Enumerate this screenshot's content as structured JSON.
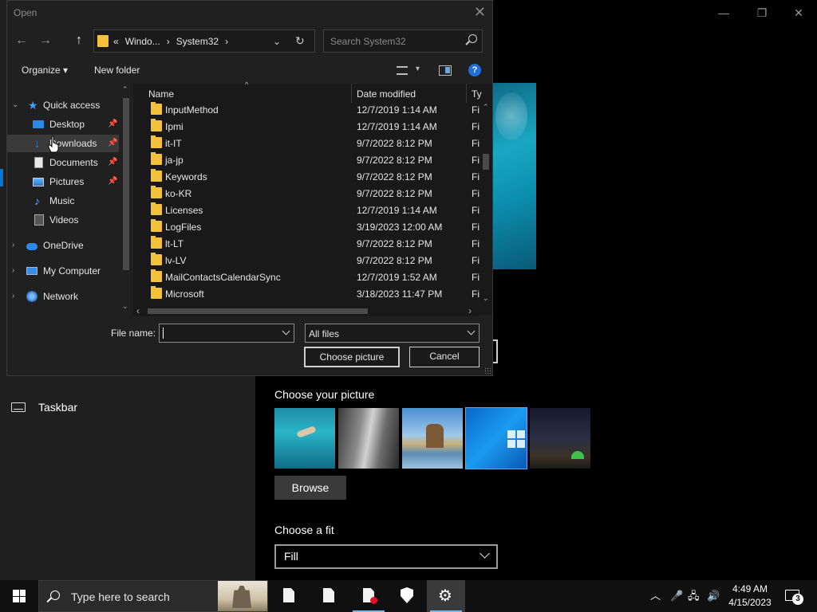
{
  "settings": {
    "window_controls": {
      "minimize": "—",
      "maximize": "❐",
      "close": "✕"
    },
    "nav": {
      "taskbar_label": "Taskbar"
    },
    "choose_picture_title": "Choose your picture",
    "browse_label": "Browse",
    "choose_fit_title": "Choose a fit",
    "fit_value": "Fill"
  },
  "dialog": {
    "title": "Open",
    "close": "✕",
    "nav": {
      "back": "←",
      "forward": "→",
      "up": "↑"
    },
    "address": {
      "prefix": "«",
      "crumbs": [
        "Windo...",
        "›",
        "System32",
        "›"
      ],
      "dropdown": "⌄",
      "refresh": "↻"
    },
    "search_placeholder": "Search System32",
    "toolbar": {
      "organize": "Organize ▾",
      "new_folder": "New folder",
      "view_dropdown": "▾",
      "help": "?"
    },
    "nav_pane": [
      {
        "label": "Quick access",
        "expander": "⌄",
        "icon": "★",
        "pinned": false
      },
      {
        "label": "Desktop",
        "pinned": true
      },
      {
        "label": "Downloads",
        "icon": "↓",
        "pinned": true,
        "selected": true
      },
      {
        "label": "Documents",
        "pinned": true
      },
      {
        "label": "Pictures",
        "pinned": true
      },
      {
        "label": "Music",
        "icon": "♪",
        "pinned": false
      },
      {
        "label": "Videos",
        "pinned": false
      },
      {
        "label": "OneDrive",
        "expander": "›",
        "pinned": false
      },
      {
        "label": "My Computer",
        "expander": "›",
        "pinned": false
      },
      {
        "label": "Network",
        "expander": "›",
        "pinned": false
      }
    ],
    "pin_glyph": "📌",
    "columns": {
      "name": "Name",
      "date": "Date modified",
      "type": "Ty"
    },
    "sort_glyph": "^",
    "files": [
      {
        "name": "InputMethod",
        "date": "12/7/2019 1:14 AM",
        "type": "Fi"
      },
      {
        "name": "Ipmi",
        "date": "12/7/2019 1:14 AM",
        "type": "Fi"
      },
      {
        "name": "it-IT",
        "date": "9/7/2022 8:12 PM",
        "type": "Fi"
      },
      {
        "name": "ja-jp",
        "date": "9/7/2022 8:12 PM",
        "type": "Fi"
      },
      {
        "name": "Keywords",
        "date": "9/7/2022 8:12 PM",
        "type": "Fi"
      },
      {
        "name": "ko-KR",
        "date": "9/7/2022 8:12 PM",
        "type": "Fi"
      },
      {
        "name": "Licenses",
        "date": "12/7/2019 1:14 AM",
        "type": "Fi"
      },
      {
        "name": "LogFiles",
        "date": "3/19/2023 12:00 AM",
        "type": "Fi"
      },
      {
        "name": "lt-LT",
        "date": "9/7/2022 8:12 PM",
        "type": "Fi"
      },
      {
        "name": "lv-LV",
        "date": "9/7/2022 8:12 PM",
        "type": "Fi"
      },
      {
        "name": "MailContactsCalendarSync",
        "date": "12/7/2019 1:52 AM",
        "type": "Fi"
      },
      {
        "name": "Microsoft",
        "date": "3/18/2023 11:47 PM",
        "type": "Fi"
      }
    ],
    "scroll_arrows": {
      "up": "⌃",
      "down": "⌄",
      "left": "‹",
      "right": "›"
    },
    "file_name_label": "File name:",
    "file_name_value": "",
    "filter_value": "All files",
    "choose_button": "Choose picture",
    "cancel_button": "Cancel"
  },
  "taskbar": {
    "search_placeholder": "Type here to search",
    "tray": {
      "chevron": "︿",
      "mic": "🎤",
      "network": "🖧",
      "volume": "🔊"
    },
    "time": "4:49 AM",
    "date": "4/15/2023",
    "notification_count": "3"
  }
}
